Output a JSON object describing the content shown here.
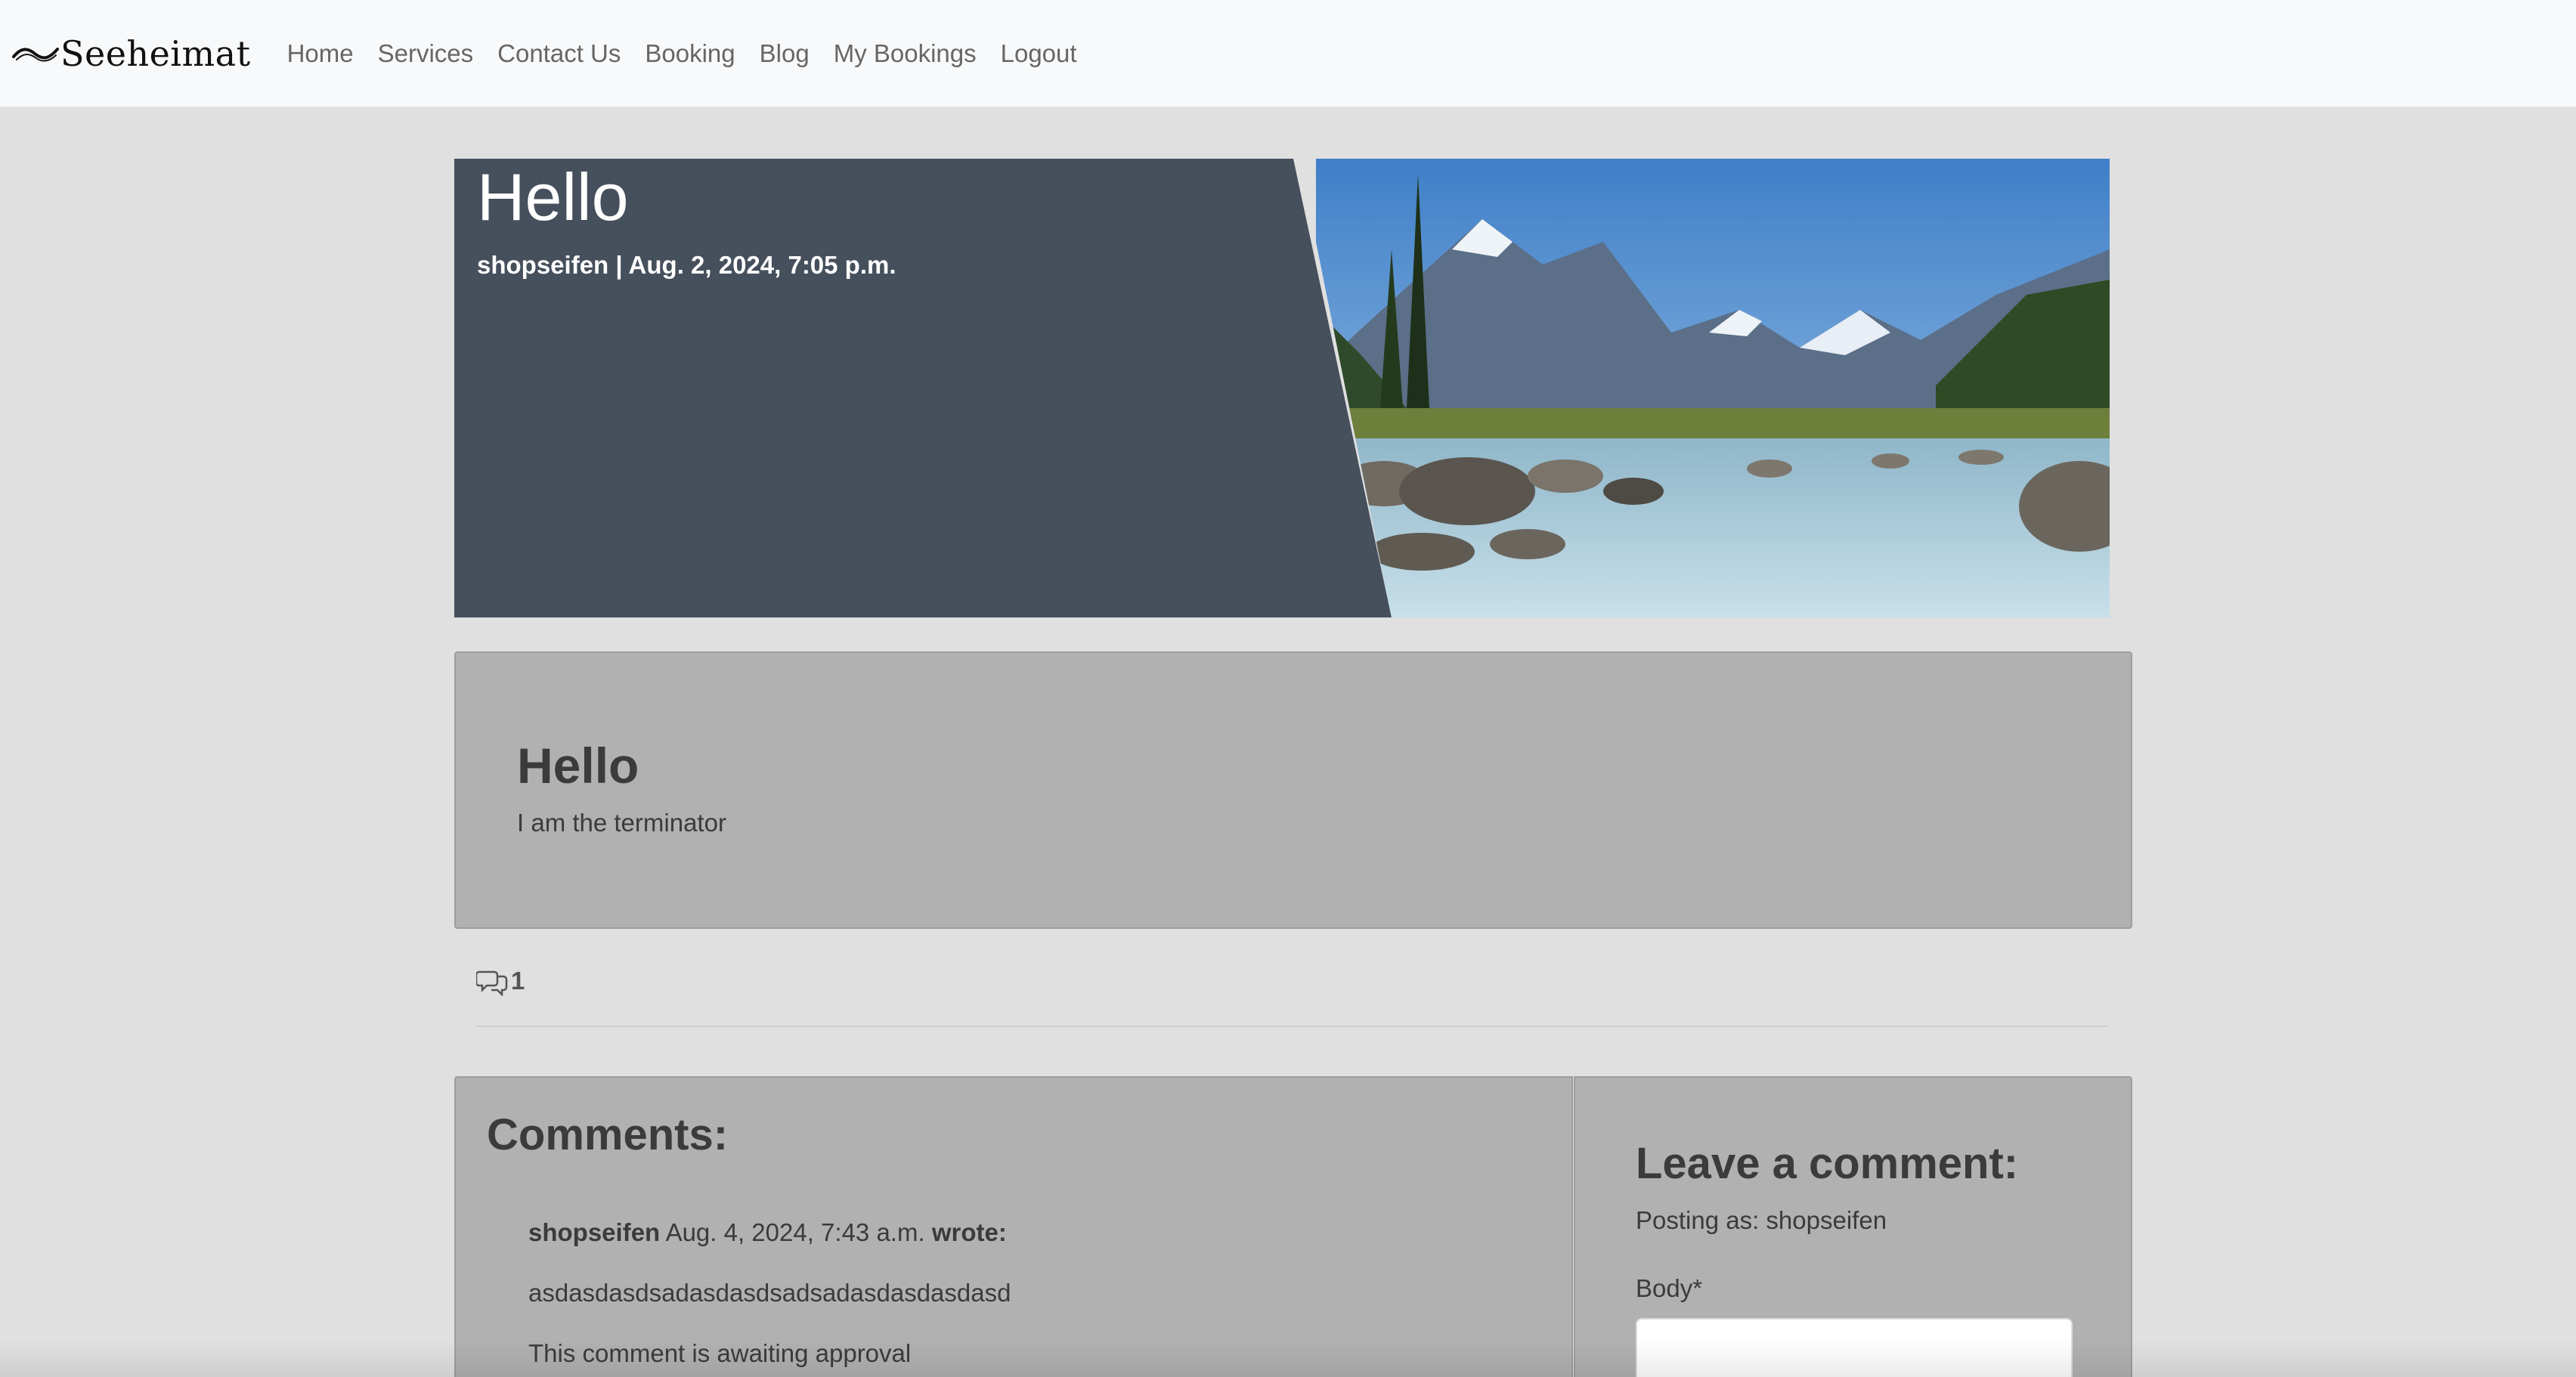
{
  "brand": {
    "name": "Seeheimat"
  },
  "nav": {
    "items": [
      {
        "label": "Home"
      },
      {
        "label": "Services"
      },
      {
        "label": "Contact Us"
      },
      {
        "label": "Booking"
      },
      {
        "label": "Blog"
      },
      {
        "label": "My Bookings"
      },
      {
        "label": "Logout"
      }
    ]
  },
  "hero": {
    "title": "Hello",
    "meta": "shopseifen | Aug. 2, 2024, 7:05 p.m."
  },
  "post": {
    "title": "Hello",
    "body": "I am the terminator"
  },
  "comment_count": "1",
  "comments": {
    "heading": "Comments:",
    "items": [
      {
        "author": "shopseifen",
        "date": "Aug. 4, 2024, 7:43 a.m.",
        "wrote": "wrote:",
        "body": "asdasdasdsadasdasdsadsadasdasdasdasd",
        "status": "This comment is awaiting approval"
      }
    ]
  },
  "leave_comment": {
    "heading": "Leave a comment:",
    "posting_as": "Posting as: shopseifen",
    "body_label": "Body*"
  },
  "colors": {
    "hero_panel": "#464f5c",
    "card": "#b1b1b1",
    "page_bg": "#e0e0e0",
    "navbar_bg": "#f8f9fa"
  },
  "icons": {
    "brand": "wave-icon",
    "comments": "chat-bubbles-icon"
  }
}
